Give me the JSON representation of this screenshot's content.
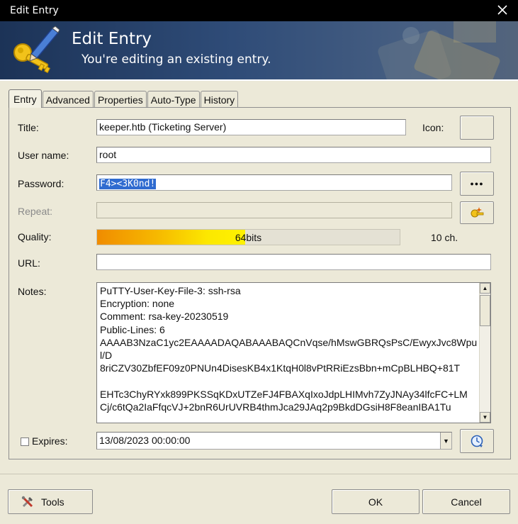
{
  "window": {
    "title": "Edit Entry"
  },
  "banner": {
    "title": "Edit Entry",
    "subtitle": "You're editing an existing entry."
  },
  "tabs": [
    {
      "label": "Entry",
      "active": true
    },
    {
      "label": "Advanced",
      "active": false
    },
    {
      "label": "Properties",
      "active": false
    },
    {
      "label": "Auto-Type",
      "active": false
    },
    {
      "label": "History",
      "active": false
    }
  ],
  "form": {
    "title_label": "Title:",
    "title_value": "keeper.htb (Ticketing Server)",
    "icon_label": "Icon:",
    "username_label": "User name:",
    "username_value": "root",
    "password_label": "Password:",
    "password_value": "F4><3K0nd!",
    "password_toggle_label": "●●●",
    "repeat_label": "Repeat:",
    "repeat_value": "",
    "quality_label": "Quality:",
    "quality_bits_num": "64",
    "quality_bits_unit": " bits",
    "quality_fraction": 0.49,
    "quality_chars": "10 ch.",
    "url_label": "URL:",
    "url_value": "",
    "notes_label": "Notes:",
    "notes_value": "PuTTY-User-Key-File-3: ssh-rsa\nEncryption: none\nComment: rsa-key-20230519\nPublic-Lines: 6\nAAAAB3NzaC1yc2EAAAADAQABAAABAQCnVqse/hMswGBRQsPsC/EwyxJvc8Wpul/D\n8riCZV30ZbfEF09z0PNUn4DisesKB4x1KtqH0l8vPtRRiEzsBbn+mCpBLHBQ+81T\n\nEHTc3ChyRYxk899PKSSqKDxUTZeFJ4FBAXqIxoJdpLHIMvh7ZyJNAy34lfcFC+LM\nCj/c6tQa2IaFfqcVJ+2bnR6UrUVRB4thmJca29JAq2p9BkdDGsiH8F8eanIBA1Tu",
    "expires_label": "Expires:",
    "expires_checked": false,
    "expires_value": "13/08/2023 00:00:00"
  },
  "buttons": {
    "tools": "Tools",
    "ok": "OK",
    "cancel": "Cancel"
  },
  "colors": {
    "banner_start": "#1c3357",
    "quality_orange": "#f08c00",
    "quality_yellow": "#fff200",
    "selection": "#2f6bd0"
  }
}
